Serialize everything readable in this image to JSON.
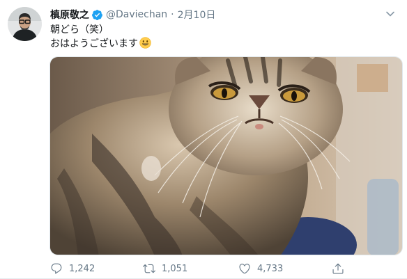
{
  "tweet": {
    "display_name": "槙原敬之",
    "handle": "@Daviechan",
    "separator": "·",
    "date": "2月10日",
    "text_line1": "朝どら（笑）",
    "text_line2": "おはようございます",
    "smiley_emoji": "grinning-face",
    "photo_subject": "exotic-shorthair-cat",
    "counts": {
      "replies": "1,242",
      "retweets": "1,051",
      "likes": "4,733"
    }
  },
  "icons": {
    "verified": "verified-badge-icon",
    "caret": "chevron-down-icon",
    "reply": "reply-icon",
    "retweet": "retweet-icon",
    "like": "heart-icon",
    "share": "share-icon"
  },
  "colors": {
    "verified_blue": "#1da1f2",
    "secondary_text": "#657786",
    "primary_text": "#14171a"
  }
}
